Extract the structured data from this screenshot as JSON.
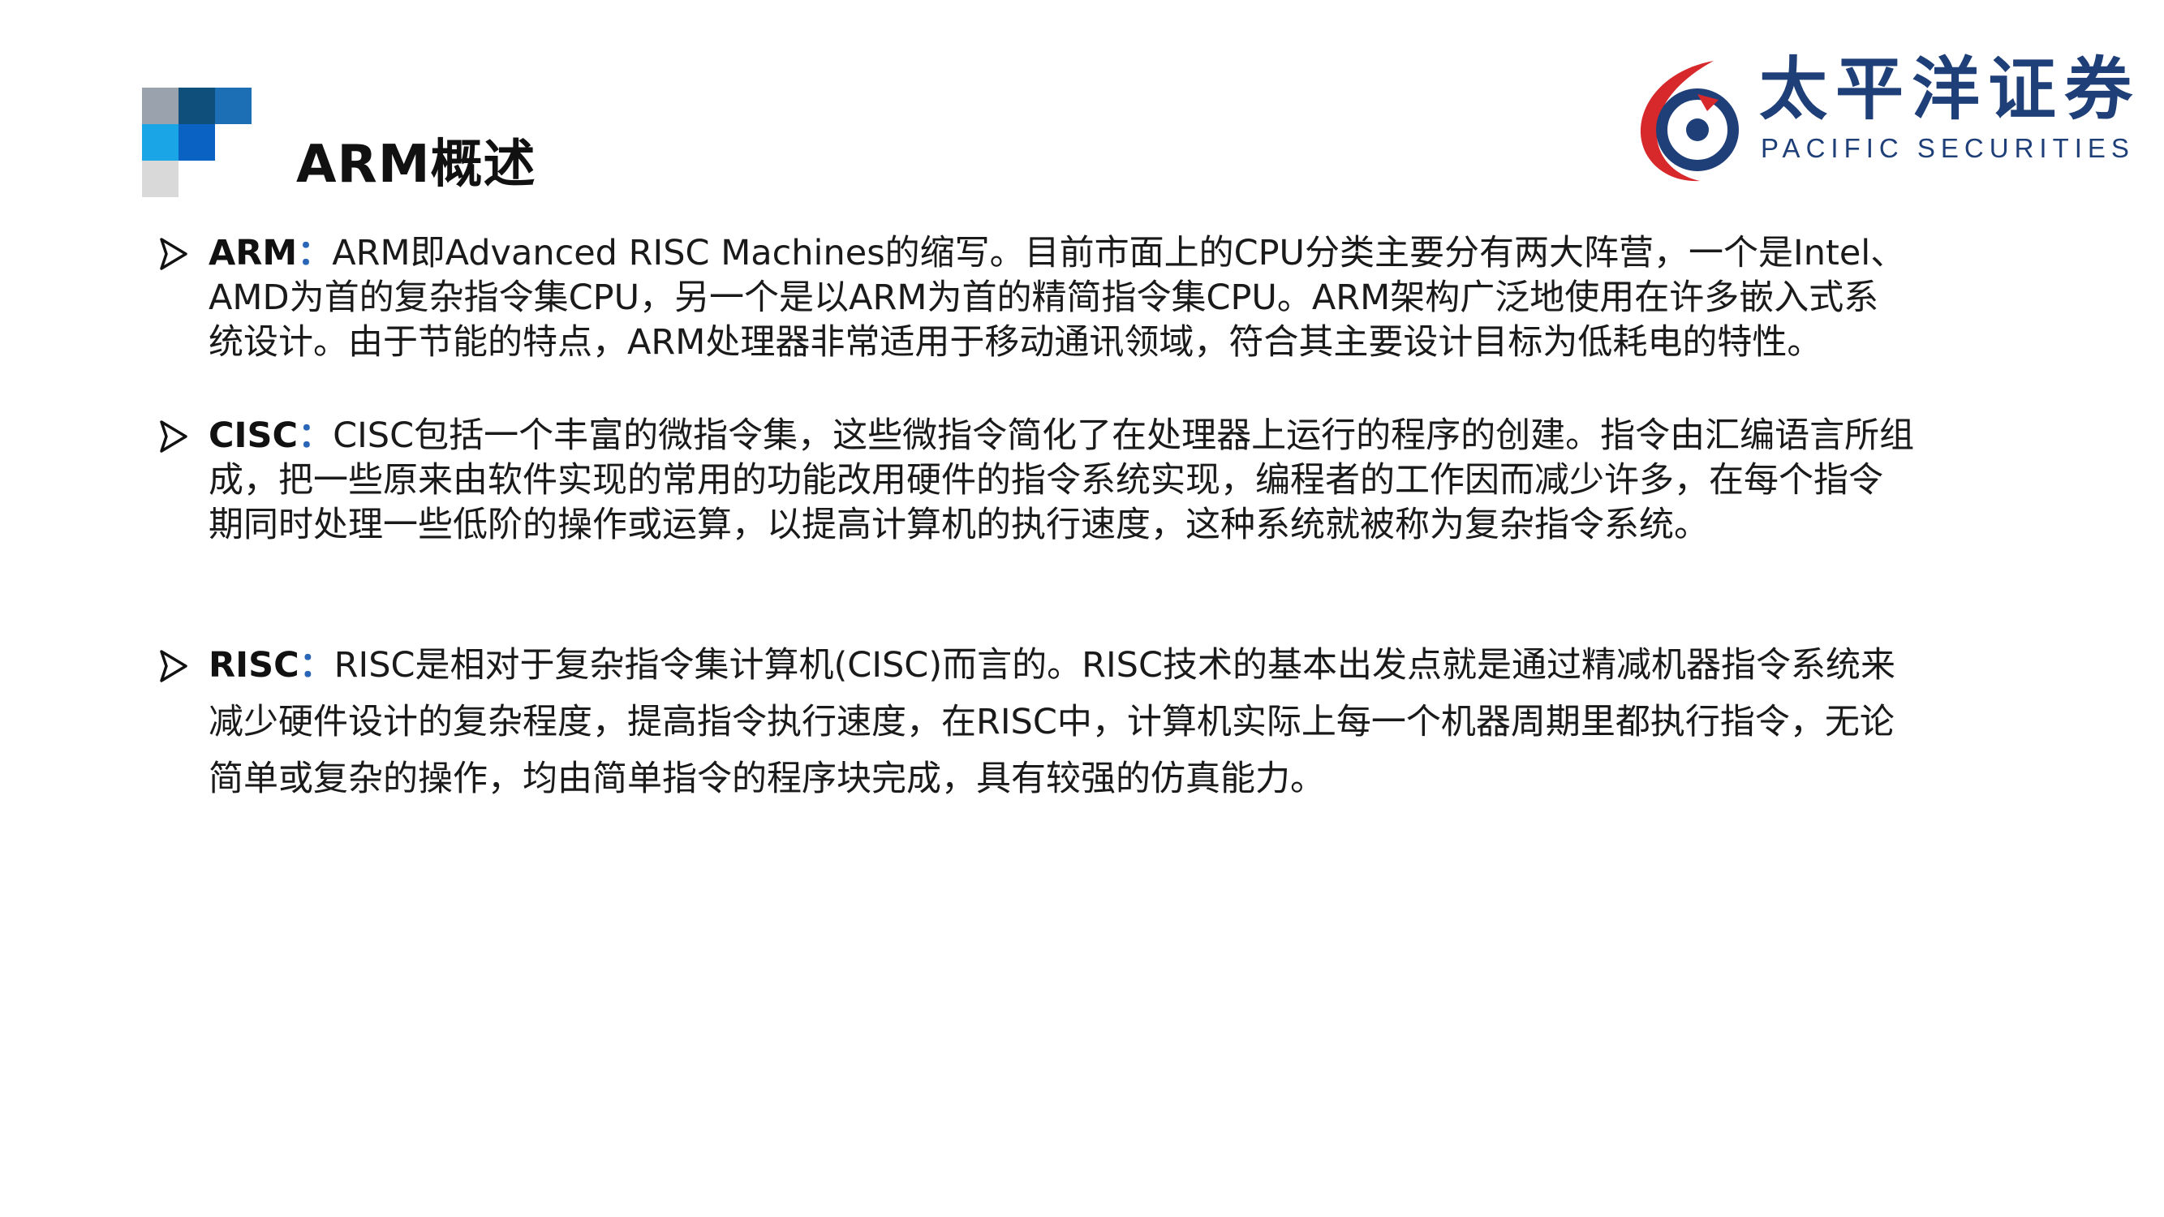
{
  "slide": {
    "title": "ARM概述"
  },
  "logo": {
    "name_cn": "太平洋证券",
    "name_en": "PACIFIC SECURITIES",
    "colors": {
      "red": "#d7282b",
      "navy": "#1f3f78"
    }
  },
  "decoration": {
    "colors": [
      "#9aa3ad",
      "#0e4f7c",
      "#1d6fb5",
      "#1aa6e6",
      "#0a62c2",
      "#d9d9d9"
    ]
  },
  "bullets": [
    {
      "term": "ARM",
      "separator": "：",
      "text": "ARM即Advanced RISC Machines的缩写。目前市面上的CPU分类主要分有两大阵营，一个是Intel、\nAMD为首的复杂指令集CPU，另一个是以ARM为首的精简指令集CPU。ARM架构广泛地使用在许多嵌入式系\n统设计。由于节能的特点，ARM处理器非常适用于移动通讯领域，符合其主要设计目标为低耗电的特性。"
    },
    {
      "term": "CISC",
      "separator": "：",
      "text": "CISC包括一个丰富的微指令集，这些微指令简化了在处理器上运行的程序的创建。指令由汇编语言所组\n成，把一些原来由软件实现的常用的功能改用硬件的指令系统实现，编程者的工作因而减少许多，在每个指令\n期同时处理一些低阶的操作或运算，以提高计算机的执行速度，这种系统就被称为复杂指令系统。"
    },
    {
      "term": "RISC",
      "separator": "：",
      "text": "RISC是相对于复杂指令集计算机(CISC)而言的。RISC技术的基本出发点就是通过精减机器指令系统来\n减少硬件设计的复杂程度，提高指令执行速度，在RISC中，计算机实际上每一个机器周期里都执行指令，无论\n简单或复杂的操作，均由简单指令的程序块完成，具有较强的仿真能力。"
    }
  ]
}
